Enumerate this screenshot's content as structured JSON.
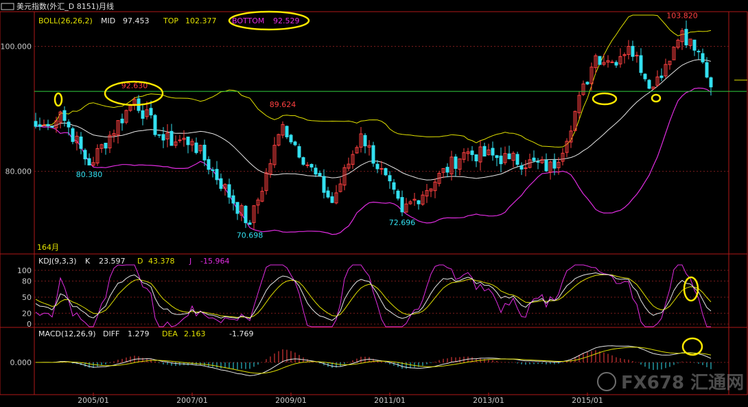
{
  "window": {
    "title": "美元指数(外汇_D 8151)月线"
  },
  "watermark": "FX678 汇通网",
  "colors": {
    "bg": "#000000",
    "frame": "#b01818",
    "grid": "#7a1c1c",
    "up": "#ff4040",
    "down": "#33e0f0",
    "label": "#c8c8c8",
    "mid": "#e8e8e8",
    "top": "#e0e000",
    "bottom": "#e02ce0",
    "support": "#30d040",
    "annotation": "#ffe800"
  },
  "chart_data": [
    {
      "type": "candlestick",
      "title": "BOLL(26,26,2)",
      "legend": [
        {
          "label": "MID",
          "value": "97.453"
        },
        {
          "label": "TOP",
          "value": "102.377"
        },
        {
          "label": "BOTTOM",
          "value": "92.529"
        }
      ],
      "bar_count_label": "164月",
      "yticks": [
        "100.000",
        "80.000"
      ],
      "ylim": [
        67,
        105
      ],
      "x": [
        "2005/01",
        "2007/01",
        "2009/01",
        "2011/01",
        "2013/01",
        "2015/01"
      ],
      "support_line": 92.8,
      "peak_labels": [
        {
          "date": "2005/11",
          "value": "92.630"
        },
        {
          "date": "2008/11",
          "value": "89.624"
        },
        {
          "date": "2016/12",
          "value": "103.820"
        }
      ],
      "trough_labels": [
        {
          "date": "2004/12",
          "value": "80.380"
        },
        {
          "date": "2008/03",
          "value": "70.698"
        },
        {
          "date": "2011/04",
          "value": "72.696"
        }
      ],
      "close_anchors": [
        {
          "date": "2003/11",
          "value": 87.2
        },
        {
          "date": "2004/02",
          "value": 87.3
        },
        {
          "date": "2004/05",
          "value": 89.5
        },
        {
          "date": "2004/12",
          "value": 81.0
        },
        {
          "date": "2005/11",
          "value": 91.5
        },
        {
          "date": "2006/06",
          "value": 85.0
        },
        {
          "date": "2007/01",
          "value": 84.8
        },
        {
          "date": "2008/03",
          "value": 71.5
        },
        {
          "date": "2008/11",
          "value": 87.5
        },
        {
          "date": "2009/11",
          "value": 75.0
        },
        {
          "date": "2010/06",
          "value": 86.0
        },
        {
          "date": "2011/04",
          "value": 73.5
        },
        {
          "date": "2012/07",
          "value": 83.0
        },
        {
          "date": "2013/06",
          "value": 82.0
        },
        {
          "date": "2014/05",
          "value": 80.5
        },
        {
          "date": "2015/03",
          "value": 98.5
        },
        {
          "date": "2015/07",
          "value": 97.5
        },
        {
          "date": "2015/11",
          "value": 100.0
        },
        {
          "date": "2016/05",
          "value": 93.5
        },
        {
          "date": "2016/12",
          "value": 102.5
        },
        {
          "date": "2017/05",
          "value": 97.5
        },
        {
          "date": "2017/07",
          "value": 93.5
        }
      ]
    },
    {
      "type": "line",
      "title": "KDJ(9,3,3)",
      "legend": [
        {
          "label": "K",
          "value": "23.597"
        },
        {
          "label": "D",
          "value": "43.378"
        },
        {
          "label": "J",
          "value": "-15.964"
        }
      ],
      "yticks": [
        "100",
        "80",
        "50",
        "20",
        "0"
      ],
      "ylim": [
        -5,
        110
      ]
    },
    {
      "type": "bar",
      "title": "MACD(12,26,9)",
      "legend": [
        {
          "label": "DIFF",
          "value": "1.279"
        },
        {
          "label": "DEA",
          "value": "2.163"
        },
        {
          "label": "",
          "value": "-1.769"
        }
      ],
      "yticks": [
        "0.000"
      ]
    }
  ]
}
